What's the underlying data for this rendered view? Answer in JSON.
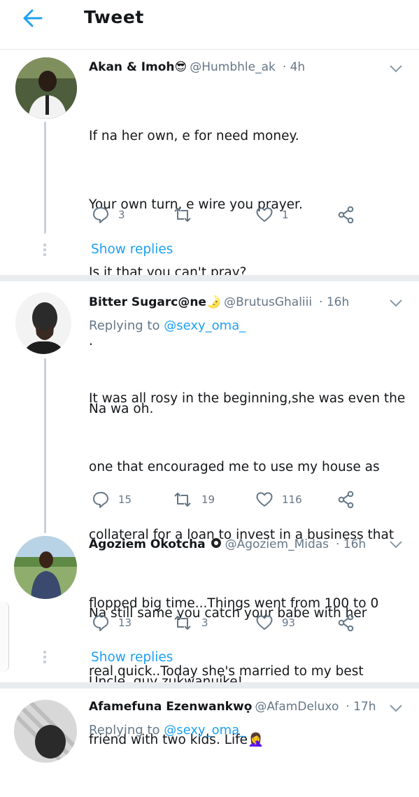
{
  "header": {
    "title": "Tweet"
  },
  "tweets": [
    {
      "name": "Akan & Imoh😎",
      "handle": "@Humbhle_ak",
      "time": "· 4h",
      "lines": [
        "If na her own, e for need money.",
        "Your own turn, e wire you prayer.",
        "Is it that you can't pray?",
        ".",
        "Na wa oh."
      ],
      "replies": "3",
      "retweets": "",
      "likes": "1",
      "show_replies": "Show replies"
    },
    {
      "name": "Bitter Sugarc@ne🌛",
      "handle": "@BrutusGhaliii",
      "time": "· 16h",
      "replying_label": "Replying to",
      "replying_to": "@sexy_oma_",
      "lines": [
        "It was all rosy in the beginning,she was even the",
        "one that encouraged me to use my house as",
        "collateral for a loan to invest in a business that",
        "flopped big time...Things went from 100 to 0",
        "real quick..Today she's married to my best",
        "friend with two kids. Life🤦‍♀️"
      ],
      "replies": "15",
      "retweets": "19",
      "likes": "116"
    },
    {
      "name": "Agoziem Okotcha",
      "handle": "@Agoziem_Midas",
      "time": "· 16h",
      "lines": [
        "Na still same you catch your babe with her",
        "Uncle, guy zukwanuike!"
      ],
      "replies": "13",
      "retweets": "3",
      "likes": "93",
      "show_replies": "Show replies"
    },
    {
      "name": "Afamefuna Ezenwankwọ",
      "handle": "@AfamDeluxo",
      "time": "· 17h",
      "replying_label": "Replying to",
      "replying_to": "@sexy_oma_"
    }
  ],
  "colors": {
    "accent": "#1da1f2",
    "muted": "#657786",
    "text": "#14171a",
    "divider": "#e6ecf0"
  },
  "icons": [
    "back-arrow-icon",
    "chevron-down-icon",
    "reply-icon",
    "retweet-icon",
    "like-icon",
    "share-icon",
    "gear-badge-icon"
  ]
}
